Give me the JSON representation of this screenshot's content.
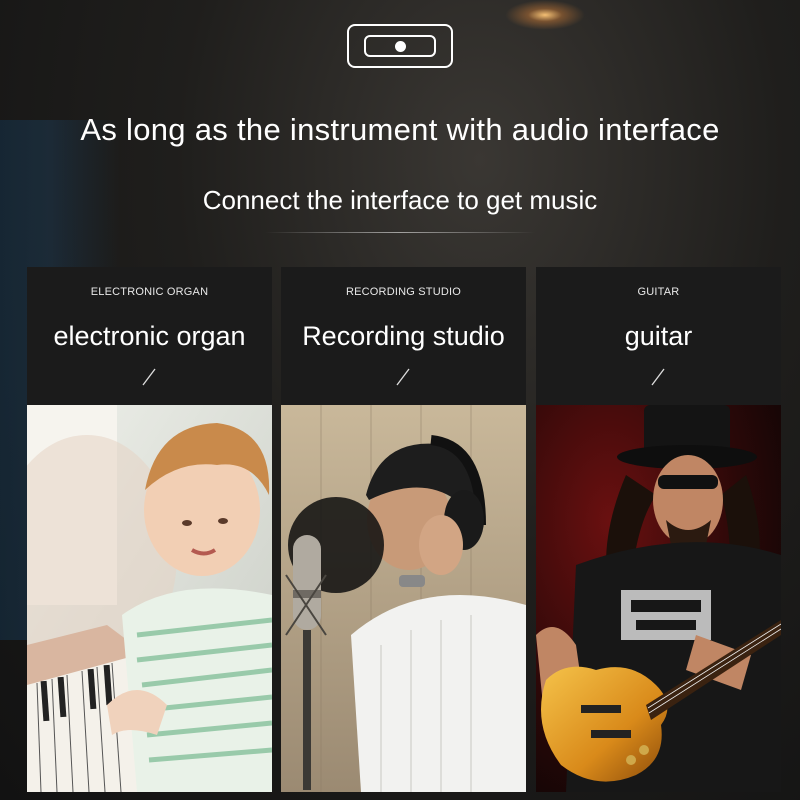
{
  "headline": "As long as the instrument with audio interface",
  "subheadline": "Connect the interface to get music",
  "badge_icon": "toggle-icon",
  "cards": [
    {
      "caption": "ELECTRONIC ORGAN",
      "title": "electronic organ",
      "photo": "child playing piano keyboard"
    },
    {
      "caption": "RECORDING STUDIO",
      "title": "Recording studio",
      "photo": "singer with headphones at studio microphone"
    },
    {
      "caption": "GUITAR",
      "title": "guitar",
      "photo": "guitarist in top hat playing electric guitar"
    }
  ],
  "colors": {
    "card_bg": "#1b1b1b",
    "text": "#ffffff",
    "guitar_body": "#e8a020"
  }
}
